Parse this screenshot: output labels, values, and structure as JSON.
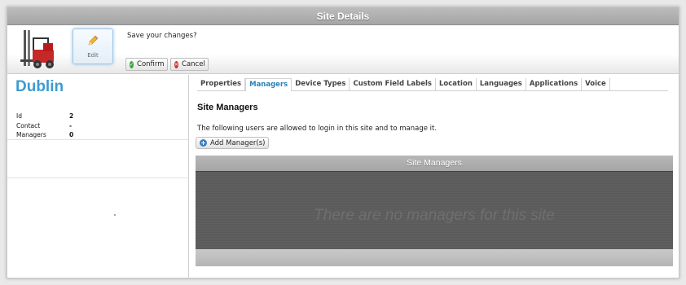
{
  "window": {
    "title": "Site Details"
  },
  "toolbar": {
    "edit_label": "Edit",
    "save_prompt": "Save your changes?",
    "confirm_label": "Confirm",
    "cancel_label": "Cancel"
  },
  "site": {
    "name": "Dublin",
    "details": [
      {
        "label": "Id",
        "value": "2"
      },
      {
        "label": "Contact",
        "value": "-"
      },
      {
        "label": "Managers",
        "value": "0"
      }
    ]
  },
  "tabs": [
    "Properties",
    "Managers",
    "Device Types",
    "Custom Field Labels",
    "Location",
    "Languages",
    "Applications",
    "Voice"
  ],
  "active_tab": "Managers",
  "managers": {
    "section_title": "Site Managers",
    "description": "The following users are allowed to login in this site and to manage it.",
    "add_button_label": "Add Manager(s)",
    "grid_title": "Site Managers",
    "empty_message": "There are no managers for this site"
  },
  "icons": {
    "app": "forklift-icon",
    "edit": "pencil-icon",
    "confirm": "check-circle-icon",
    "cancel": "x-circle-icon",
    "add": "plus-circle-icon"
  },
  "colors": {
    "accent": "#3d9bd0",
    "active_tab": "#2b83b6",
    "confirm": "#3ca63c",
    "cancel": "#cc3333"
  }
}
